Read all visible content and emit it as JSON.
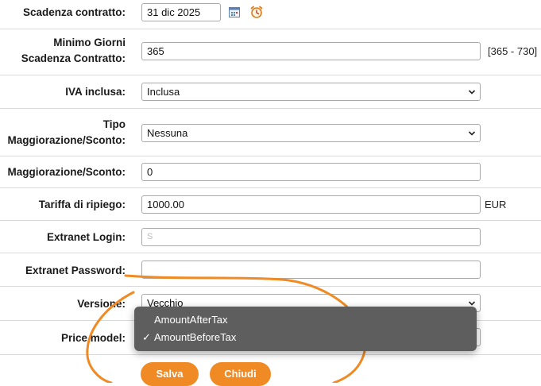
{
  "form": {
    "contract_expiry": {
      "label": "Scadenza contratto:",
      "value": "31 dic 2025",
      "calendar_icon": "calendar-icon",
      "alarm_icon": "alarm-clock-icon"
    },
    "min_days": {
      "label_line1": "Minimo Giorni",
      "label_line2": "Scadenza Contratto:",
      "value": "365",
      "range": "[365 - 730]"
    },
    "vat": {
      "label": "IVA inclusa:",
      "value": "Inclusa"
    },
    "markup_type": {
      "label_line1": "Tipo",
      "label_line2": "Maggiorazione/Sconto:",
      "value": "Nessuna"
    },
    "markup": {
      "label": "Maggiorazione/Sconto:",
      "value": "0"
    },
    "fallback_rate": {
      "label": "Tariffa di ripiego:",
      "value": "1000.00",
      "currency": "EUR"
    },
    "extranet_login": {
      "label": "Extranet Login:",
      "value": "S"
    },
    "extranet_password": {
      "label": "Extranet Password:",
      "value": ""
    },
    "version": {
      "label": "Versione:",
      "value": "Vecchio"
    },
    "price_model": {
      "label": "Price model:",
      "options": [
        {
          "label": "AmountAfterTax",
          "selected": false
        },
        {
          "label": "AmountBeforeTax",
          "selected": true
        }
      ],
      "check_mark": "✓"
    }
  },
  "buttons": {
    "save": "Salva",
    "close": "Chiudi"
  },
  "colors": {
    "accent": "#f08a24",
    "dropdown_bg": "#5e5e5e",
    "annotation": "#f08a24"
  }
}
